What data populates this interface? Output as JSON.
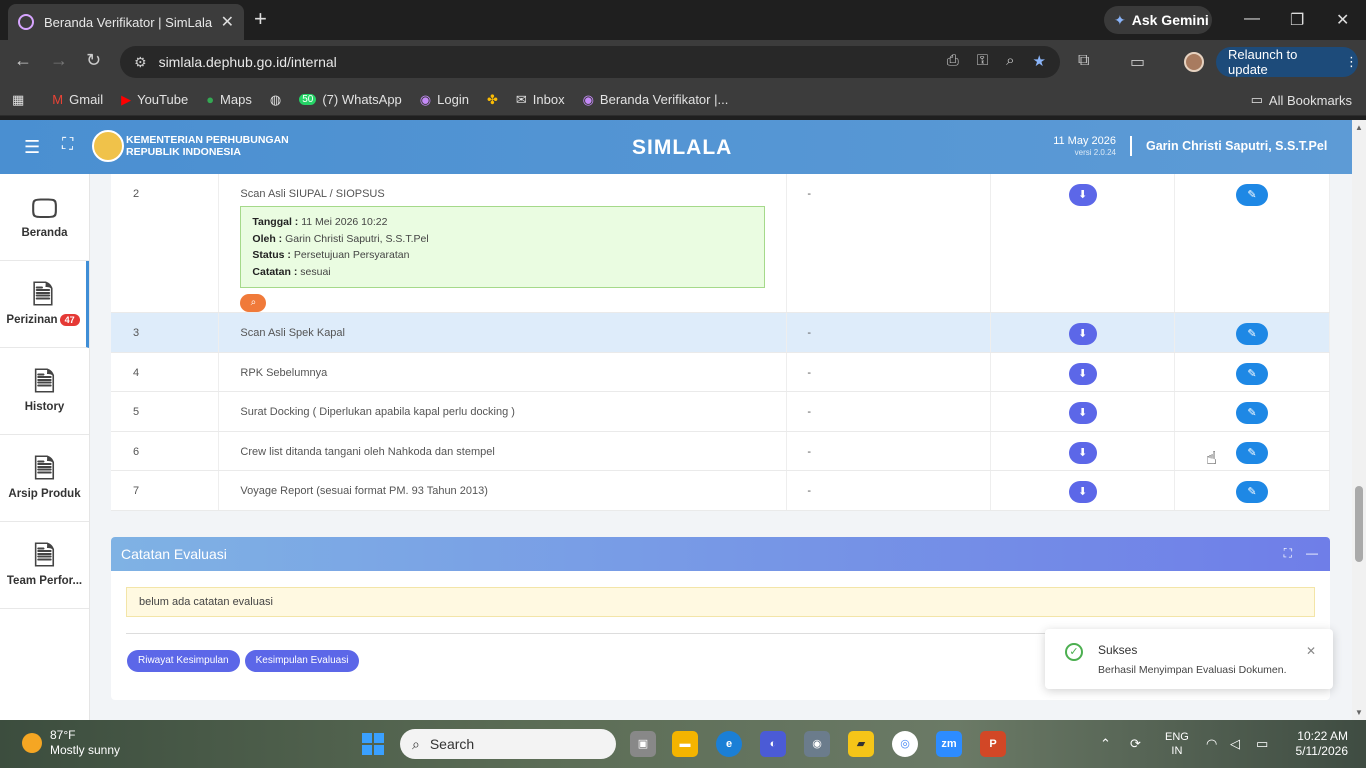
{
  "browser": {
    "tab_title": "Beranda Verifikator | SimLala",
    "ask_gemini": "Ask Gemini",
    "url": "simlala.dephub.go.id/internal",
    "relaunch": "Relaunch to update",
    "bookmarks": [
      "Gmail",
      "YouTube",
      "Maps",
      "(7) WhatsApp",
      "Login",
      "Inbox",
      "Beranda Verifikator |..."
    ],
    "whatsapp_count": "50",
    "all_bookmarks": "All Bookmarks"
  },
  "header": {
    "ministry_line1": "KEMENTERIAN PERHUBUNGAN",
    "ministry_line2": "REPUBLIK INDONESIA",
    "app_title": "SIMLALA",
    "date": "11 May 2026",
    "version": "versi 2.0.24",
    "user": "Garin Christi Saputri, S.S.T.Pel"
  },
  "sidebar": {
    "items": [
      {
        "label": "Beranda"
      },
      {
        "label": "Perizinan",
        "badge": "47"
      },
      {
        "label": "History"
      },
      {
        "label": "Arsip Produk"
      },
      {
        "label": "Team Perfor..."
      }
    ]
  },
  "documents": {
    "rows": [
      {
        "no": "2",
        "name": "Scan Asli SIUPAL / SIOPSUS",
        "value": "-"
      },
      {
        "no": "3",
        "name": "Scan Asli Spek Kapal",
        "value": "-"
      },
      {
        "no": "4",
        "name": "RPK Sebelumnya",
        "value": "-"
      },
      {
        "no": "5",
        "name": "Surat Docking ( Diperlukan apabila kapal perlu docking )",
        "value": "-"
      },
      {
        "no": "6",
        "name": "Crew list ditanda tangani oleh Nahkoda dan stempel",
        "value": "-"
      },
      {
        "no": "7",
        "name": "Voyage Report (sesuai format PM. 93 Tahun 2013)",
        "value": "-"
      }
    ],
    "note": {
      "tanggal_label": "Tanggal :",
      "tanggal": "11 Mei 2026 10:22",
      "oleh_label": "Oleh :",
      "oleh": "Garin Christi Saputri, S.S.T.Pel",
      "status_label": "Status :",
      "status": "Persetujuan Persyaratan",
      "catatan_label": "Catatan :",
      "catatan": "sesuai"
    }
  },
  "evaluasi": {
    "title": "Catatan Evaluasi",
    "empty_note": "belum ada catatan evaluasi",
    "btn_riwayat": "Riwayat Kesimpulan",
    "btn_kesimpulan": "Kesimpulan Evaluasi"
  },
  "toast": {
    "title": "Sukses",
    "message": "Berhasil Menyimpan Evaluasi Dokumen."
  },
  "taskbar": {
    "temp": "87°F",
    "weather": "Mostly sunny",
    "search": "Search",
    "lang1": "ENG",
    "lang2": "IN",
    "time": "10:22 AM",
    "date": "5/11/2026"
  },
  "colors": {
    "header": "#4a8fd1",
    "download_btn": "#5c67e8",
    "edit_btn": "#1e88e5",
    "highlight_row": "#deecfa",
    "note_bg": "#eafce1",
    "eval_note_bg": "#fff9e1"
  }
}
